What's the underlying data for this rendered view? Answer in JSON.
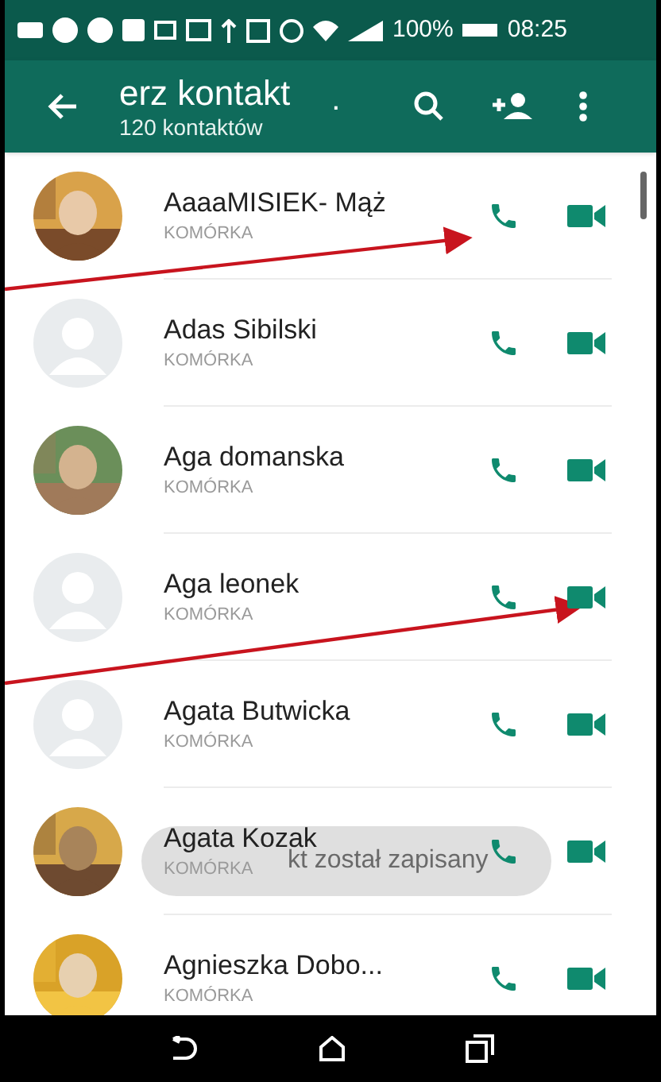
{
  "status_bar": {
    "battery": "100%",
    "time": "08:25"
  },
  "app_bar": {
    "title": "erz kontakt",
    "subtitle": "120 kontaktów",
    "dot": "."
  },
  "contacts": [
    {
      "name": "AaaaMISIEK- Mąż",
      "type": "KOMÓRKA",
      "kind": "picture"
    },
    {
      "name": "Adas Sibilski",
      "type": "KOMÓRKA",
      "kind": "placeholder"
    },
    {
      "name": "Aga domanska",
      "type": "KOMÓRKA",
      "kind": "picture"
    },
    {
      "name": "Aga leonek",
      "type": "KOMÓRKA",
      "kind": "placeholder"
    },
    {
      "name": "Agata Butwicka",
      "type": "KOMÓRKA",
      "kind": "placeholder"
    },
    {
      "name": "Agata Kozak",
      "type": "KOMÓRKA",
      "kind": "picture"
    },
    {
      "name": "Agnieszka Dobo...",
      "type": "KOMÓRKA",
      "kind": "picture"
    }
  ],
  "toast": {
    "text": "kt został zapisany"
  }
}
